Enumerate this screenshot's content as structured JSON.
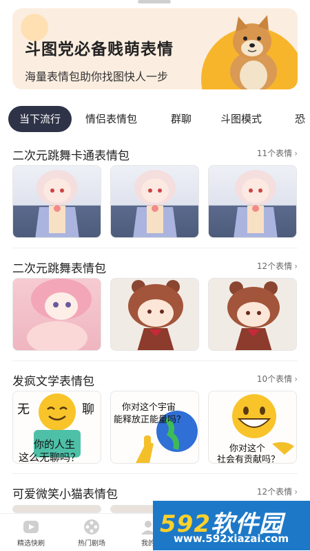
{
  "banner": {
    "title": "斗图党必备贱萌表情",
    "subtitle": "海量表情包助你找图快人一步"
  },
  "tabs": [
    {
      "label": "当下流行",
      "active": true
    },
    {
      "label": "情侣表情包",
      "active": false
    },
    {
      "label": "群聊",
      "active": false
    },
    {
      "label": "斗图模式",
      "active": false
    },
    {
      "label": "恐",
      "active": false
    }
  ],
  "sections": [
    {
      "title": "二次元跳舞卡通表情包",
      "count": "11个表情"
    },
    {
      "title": "二次元跳舞表情包",
      "count": "12个表情"
    },
    {
      "title": "发疯文学表情包",
      "count": "10个表情"
    },
    {
      "title": "可爱微笑小猫表情包",
      "count": "12个表情"
    }
  ],
  "memes": {
    "m1_left": "无",
    "m1_right": "聊",
    "m1_bottom1": "你的人生",
    "m1_bottom2": "这么无聊吗？",
    "m2_top1": "你对这个宇宙",
    "m2_top2": "能释放正能量吗？",
    "m3_bottom1": "你对这个",
    "m3_bottom2": "社会有贡献吗？"
  },
  "bottom_nav": [
    {
      "label": "精选快刷",
      "icon": "play-icon"
    },
    {
      "label": "热门剧场",
      "icon": "film-reel-icon"
    },
    {
      "label": "我的",
      "icon": "profile-icon"
    }
  ],
  "watermark": {
    "num": "592",
    "brand": "软件园",
    "url": "www.592xiazai.com"
  },
  "colors": {
    "tab_active_bg": "#2f3347",
    "banner_bg": "#fbeee0",
    "banner_accent": "#f7b52c",
    "watermark_bg": "#1d79c8"
  }
}
